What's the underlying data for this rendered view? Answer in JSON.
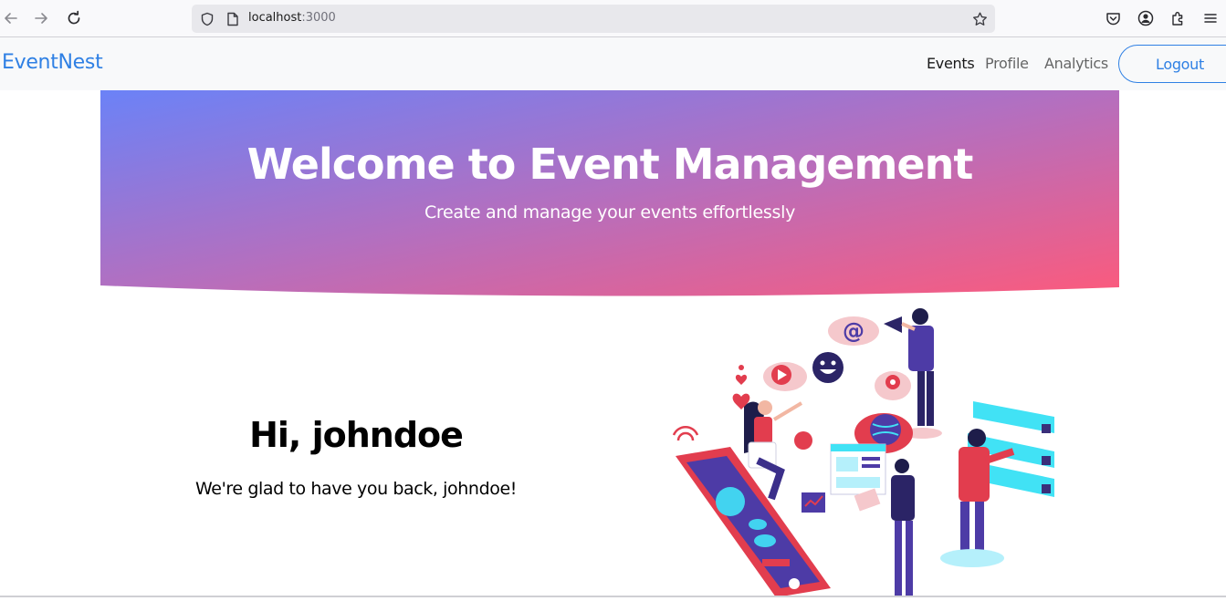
{
  "browser": {
    "url_host": "localhost",
    "url_port": ":3000"
  },
  "navbar": {
    "brand": "EventNest",
    "links": [
      {
        "label": "Events",
        "active": true
      },
      {
        "label": "Profile",
        "active": false
      },
      {
        "label": "Analytics",
        "active": false
      }
    ],
    "logout_label": "Logout"
  },
  "hero": {
    "title": "Welcome to Event Management",
    "subtitle": "Create and manage your events effortlessly",
    "gradient_start": "#6b82f7",
    "gradient_end": "#fc5a7c"
  },
  "welcome": {
    "greeting": "Hi, johndoe",
    "message": "We're glad to have you back, johndoe!"
  },
  "colors": {
    "brand": "#2f80e4",
    "welcome_bg": "#efebf7"
  }
}
